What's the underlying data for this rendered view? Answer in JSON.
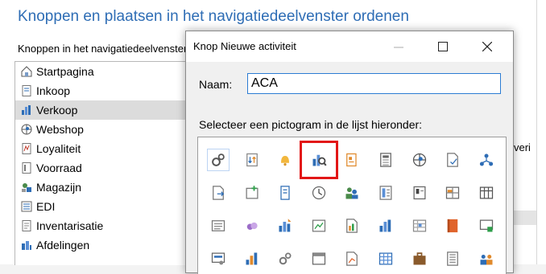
{
  "background": {
    "title": "Knoppen en plaatsen in het navigatiedeelvenster ordenen",
    "subtitle": "Knoppen in het navigatiedeelvenster",
    "right_text": "veri",
    "list_items": [
      {
        "label": "Startpagina",
        "icon": "house-icon",
        "selected": false
      },
      {
        "label": "Inkoop",
        "icon": "document-icon",
        "selected": false
      },
      {
        "label": "Verkoop",
        "icon": "bar-chart-icon",
        "selected": true
      },
      {
        "label": "Webshop",
        "icon": "globe-icon",
        "selected": false
      },
      {
        "label": "Loyaliteit",
        "icon": "certificate-icon",
        "selected": false
      },
      {
        "label": "Voorraad",
        "icon": "inventory-icon",
        "selected": false
      },
      {
        "label": "Magazijn",
        "icon": "warehouse-icon",
        "selected": false
      },
      {
        "label": "EDI",
        "icon": "edi-icon",
        "selected": false
      },
      {
        "label": "Inventarisatie",
        "icon": "checklist-icon",
        "selected": false
      },
      {
        "label": "Afdelingen",
        "icon": "departments-icon",
        "selected": false
      }
    ]
  },
  "dialog": {
    "title": "Knop Nieuwe activiteit",
    "name_label": "Naam:",
    "name_value": "ACA",
    "pick_label": "Selecteer een pictogram in de lijst hieronder:",
    "selected_icon": "sales-analysis-icon",
    "icons": [
      "settings-gears-icon",
      "sort-icon",
      "bell-icon",
      "sales-analysis-icon",
      "price-tag-icon",
      "calculator-icon",
      "globe-icon",
      "document-check-icon",
      "network-icon",
      "document-export-icon",
      "document-add-icon",
      "form-icon",
      "clock-icon",
      "people-icon",
      "ledger-icon",
      "contact-card-icon",
      "table-icon",
      "grid-icon",
      "report-icon",
      "purple-shape-icon",
      "bar-chart-up-icon",
      "chart-edit-icon",
      "chart-doc-icon",
      "bar-chart-icon",
      "spreadsheet-icon",
      "orange-book-icon",
      "screen-icon",
      "screen-settings-icon",
      "chart-bars-icon",
      "settings-icon",
      "window-icon",
      "document-chart-icon",
      "spreadsheet-blue-icon",
      "briefcase-icon",
      "document-lines-icon",
      "team-icon"
    ]
  },
  "colors": {
    "accent": "#2e6db5",
    "highlight": "#e21717"
  }
}
